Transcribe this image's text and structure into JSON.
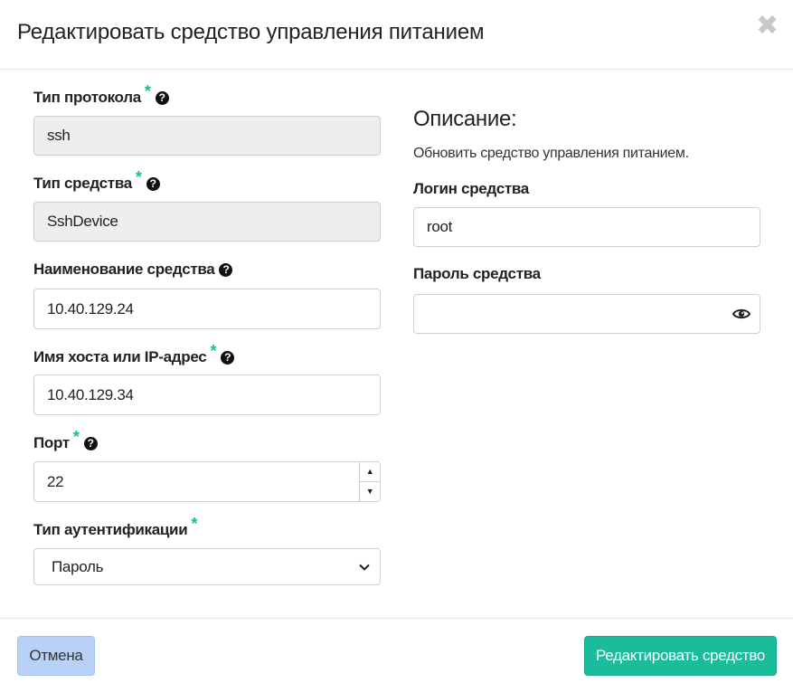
{
  "modal": {
    "title": "Редактировать средство управления питанием",
    "close_glyph": "✖"
  },
  "form": {
    "protocol": {
      "label": "Тип протокола",
      "required": "*",
      "value": "ssh"
    },
    "device_type": {
      "label": "Тип средства",
      "required": "*",
      "value": "SshDevice"
    },
    "device_name": {
      "label": "Наименование средства",
      "value": "10.40.129.24"
    },
    "host": {
      "label": "Имя хоста или IP-адрес",
      "required": "*",
      "value": "10.40.129.34"
    },
    "port": {
      "label": "Порт",
      "required": "*",
      "value": "22"
    },
    "auth_type": {
      "label": "Тип аутентификации",
      "required": "*",
      "value": "Пароль"
    },
    "login": {
      "label": "Логин средства",
      "value": "root"
    },
    "password": {
      "label": "Пароль средства",
      "value": ""
    }
  },
  "description": {
    "title": "Описание:",
    "text": "Обновить средство управления питанием."
  },
  "footer": {
    "cancel_label": "Отмена",
    "submit_label": "Редактировать средство"
  },
  "icons": {
    "help": "question-circle-icon",
    "eye": "eye-icon",
    "chevron": "chevron-down-icon"
  },
  "colors": {
    "accent": "#1abc9c",
    "cancel_bg": "#b9d1f5",
    "readonly_bg": "#eeeeee"
  }
}
